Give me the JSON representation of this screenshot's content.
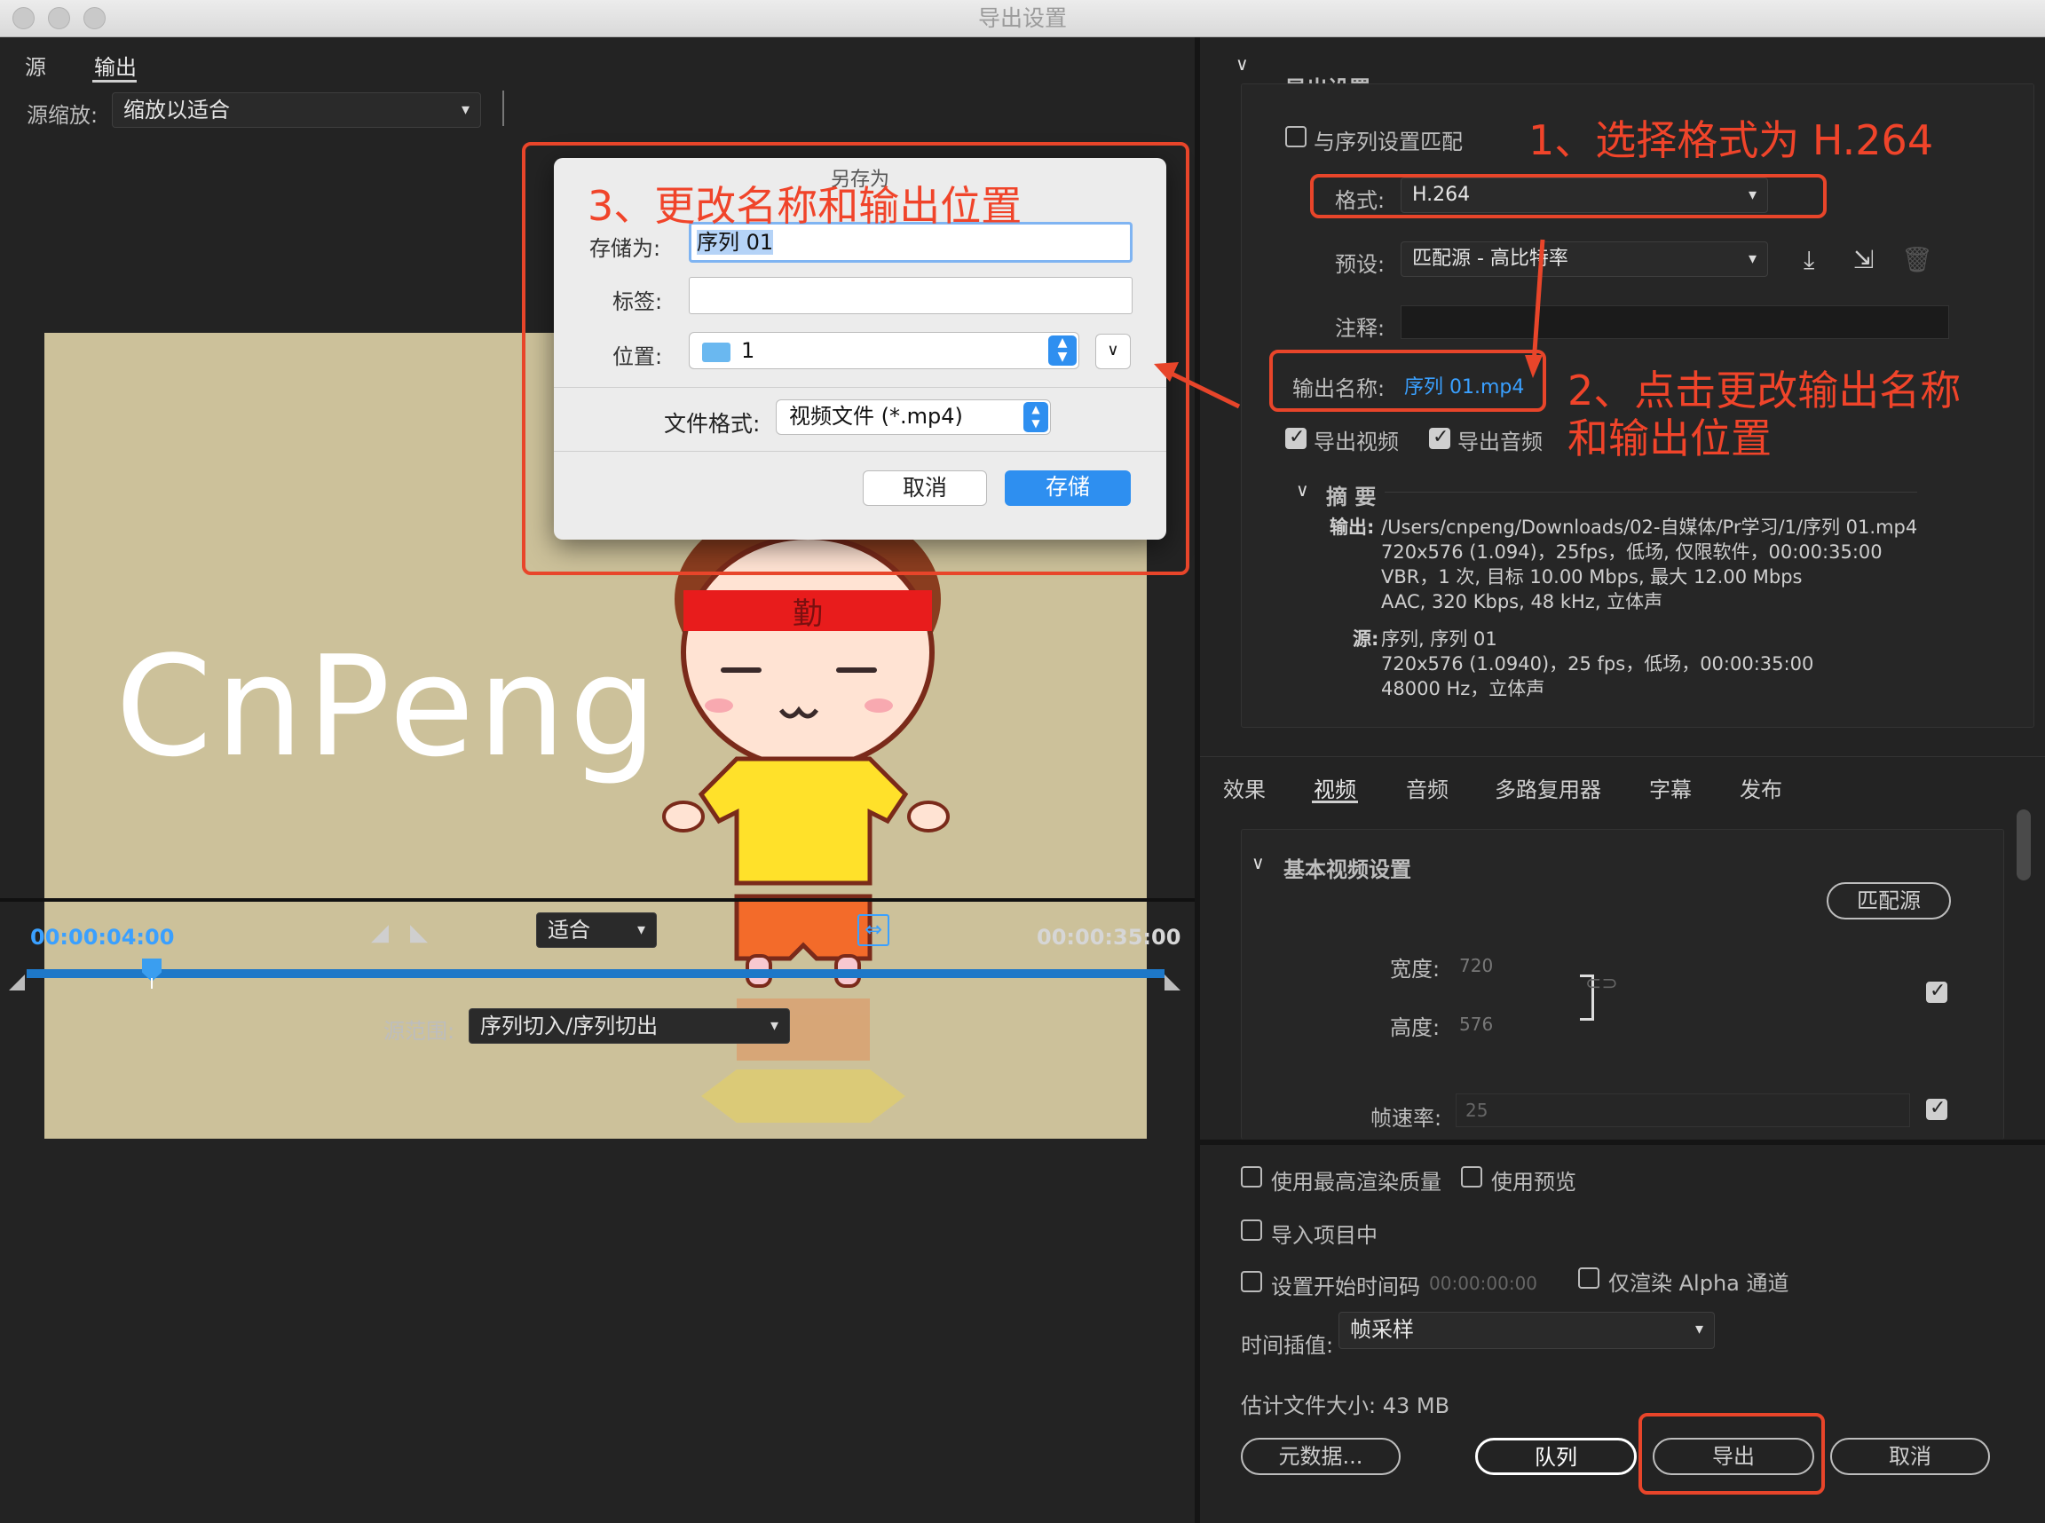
{
  "window": {
    "title": "导出设置"
  },
  "left": {
    "tabs": [
      "源",
      "输出"
    ],
    "zoom_label": "源缩放:",
    "zoom_value": "缩放以适合",
    "preview_text": "CnPeng",
    "headband_text": "勤",
    "timecode_current": "00:00:04:00",
    "fit_value": "适合",
    "timecode_total": "00:00:35:00",
    "progress": 0.11,
    "range_label": "源范围:",
    "range_value": "序列切入/序列切出"
  },
  "dialog": {
    "title": "另存为",
    "save_as_label": "存储为:",
    "save_as_value": "序列 01",
    "tags_label": "标签:",
    "location_label": "位置:",
    "location_value": "1",
    "format_label": "文件格式:",
    "format_value": "视频文件 (*.mp4)",
    "cancel": "取消",
    "save": "存储"
  },
  "export": {
    "section": "导出设置",
    "match_sequence": "与序列设置匹配",
    "format_label": "格式:",
    "format_value": "H.264",
    "preset_label": "预设:",
    "preset_value": "匹配源 - 高比特率",
    "comment_label": "注释:",
    "output_name_label": "输出名称:",
    "output_name_value": "序列 01.mp4",
    "export_video": "导出视频",
    "export_audio": "导出音频",
    "summary_title": "摘 要",
    "output_label": "输出:",
    "output_lines": [
      "/Users/cnpeng/Downloads/02-自媒体/Pr学习/1/序列 01.mp4",
      "720x576 (1.094)，25fps，低场, 仅限软件，00:00:35:00",
      "VBR，1 次, 目标 10.00 Mbps, 最大 12.00 Mbps",
      "AAC, 320 Kbps, 48  kHz, 立体声"
    ],
    "source_label": "源:",
    "source_lines": [
      "序列, 序列 01",
      "720x576 (1.0940)，25 fps，低场，00:00:35:00",
      "48000 Hz，立体声"
    ]
  },
  "tabs2": [
    "效果",
    "视频",
    "音频",
    "多路复用器",
    "字幕",
    "发布"
  ],
  "video": {
    "section": "基本视频设置",
    "match_source": "匹配源",
    "width_label": "宽度:",
    "width_value": "720",
    "height_label": "高度:",
    "height_value": "576",
    "fps_label": "帧速率:",
    "fps_value": "25"
  },
  "bottom": {
    "max_quality": "使用最高渲染质量",
    "use_preview": "使用预览",
    "import_project": "导入项目中",
    "start_timecode": "设置开始时间码",
    "start_timecode_value": "00:00:00:00",
    "alpha_only": "仅渲染 Alpha 通道",
    "interp_label": "时间插值:",
    "interp_value": "帧采样",
    "est_size": "估计文件大小: 43 MB",
    "metadata": "元数据...",
    "queue": "队列",
    "export": "导出",
    "cancel": "取消"
  },
  "annotations": {
    "step1": "1、选择格式为 H.264",
    "step2_line1": "2、点击更改输出名称",
    "step2_line2": "和输出位置",
    "step3": "3、更改名称和输出位置"
  },
  "colors": {
    "annotation": "#e8452a",
    "accent": "#2e8ff0",
    "link": "#3aa0ff"
  }
}
